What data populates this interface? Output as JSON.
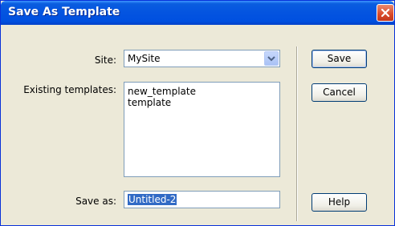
{
  "dialog": {
    "title": "Save As Template",
    "close_icon": "close-icon"
  },
  "form": {
    "site_label": "Site:",
    "site_value": "MySite",
    "existing_label": "Existing templates:",
    "templates": [
      "new_template",
      "template"
    ],
    "save_as_label": "Save as:",
    "save_as_value": "Untitled-2"
  },
  "buttons": {
    "save": "Save",
    "cancel": "Cancel",
    "help": "Help"
  },
  "colors": {
    "title_bar": "#0454e0",
    "close_button": "#d9492a",
    "dialog_bg": "#ece9d8",
    "selection": "#316ac5"
  }
}
